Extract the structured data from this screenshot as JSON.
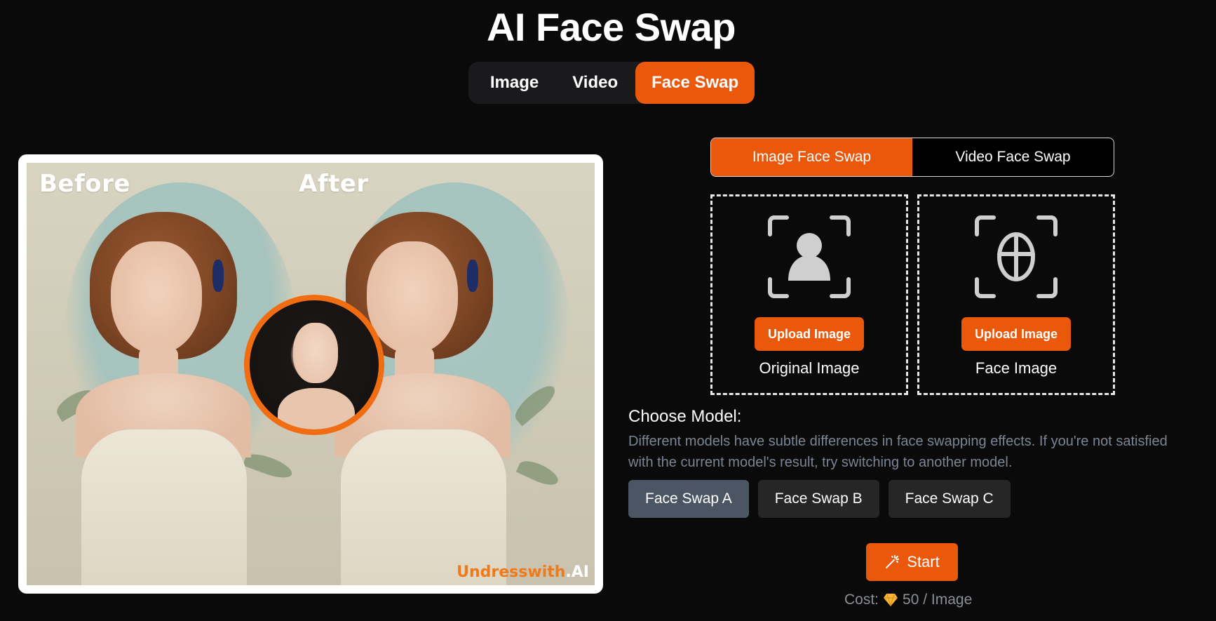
{
  "page": {
    "title": "AI Face Swap"
  },
  "mode_tabs": [
    {
      "label": "Image"
    },
    {
      "label": "Video"
    },
    {
      "label": "Face Swap",
      "active": true
    }
  ],
  "preview": {
    "before_label": "Before",
    "after_label": "After",
    "watermark_brand": "Undresswith",
    "watermark_suffix": ".AI"
  },
  "swap_tabs": [
    {
      "label": "Image Face Swap",
      "active": true
    },
    {
      "label": "Video Face Swap"
    }
  ],
  "uploads": [
    {
      "button": "Upload Image",
      "label": "Original Image",
      "icon": "person-frame-icon"
    },
    {
      "button": "Upload Image",
      "label": "Face Image",
      "icon": "face-frame-icon"
    }
  ],
  "model": {
    "title": "Choose Model:",
    "description": "Different models have subtle differences in face swapping effects. If you're not satisfied with the current model's result, try switching to another model.",
    "options": [
      {
        "label": "Face Swap A",
        "active": true
      },
      {
        "label": "Face Swap B"
      },
      {
        "label": "Face Swap C"
      }
    ]
  },
  "start": {
    "label": "Start",
    "icon": "magic-wand-icon"
  },
  "cost": {
    "prefix": "Cost:",
    "icon": "diamond-icon",
    "value": "50 / Image"
  },
  "colors": {
    "accent": "#ea580c",
    "background": "#0b0a0a",
    "active_model": "#4b5563"
  }
}
